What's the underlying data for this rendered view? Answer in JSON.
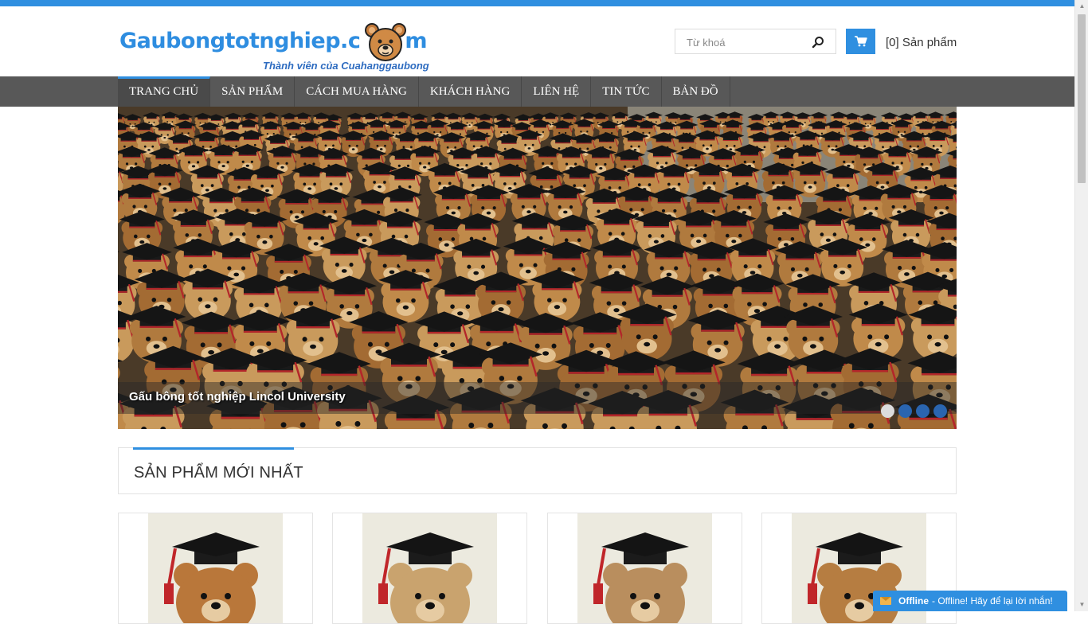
{
  "header": {
    "logo_text": "Gaubongtotnghiep.c",
    "logo_text_tail": "m",
    "logo_tagline": "Thành viên của Cuahanggaubong",
    "search_placeholder": "Từ khoá",
    "cart_label": "[0] Sản phẩm"
  },
  "nav": {
    "items": [
      {
        "label": "TRANG CHỦ",
        "active": true
      },
      {
        "label": "SẢN PHẨM",
        "active": false
      },
      {
        "label": "CÁCH MUA HÀNG",
        "active": false
      },
      {
        "label": "KHÁCH HÀNG",
        "active": false
      },
      {
        "label": "LIÊN HỆ",
        "active": false
      },
      {
        "label": "TIN TỨC",
        "active": false
      },
      {
        "label": "BẢN ĐỒ",
        "active": false
      }
    ]
  },
  "slider": {
    "caption": "Gấu bông tốt nghiệp Lincol University",
    "slide_count": 4,
    "active_index": 0
  },
  "section": {
    "title": "SẢN PHẨM MỚI NHẤT"
  },
  "products": [
    {
      "image": "graduation-bear-photo"
    },
    {
      "image": "graduation-bear-photo"
    },
    {
      "image": "graduation-bear-photo"
    },
    {
      "image": "graduation-bear-photo"
    }
  ],
  "chat": {
    "status": "Offline",
    "message": "- Offline! Hãy để lại lời nhắn!"
  },
  "colors": {
    "accent": "#2f8fe0",
    "nav_bg": "#585858",
    "chat_bg": "#2f8fe0"
  }
}
